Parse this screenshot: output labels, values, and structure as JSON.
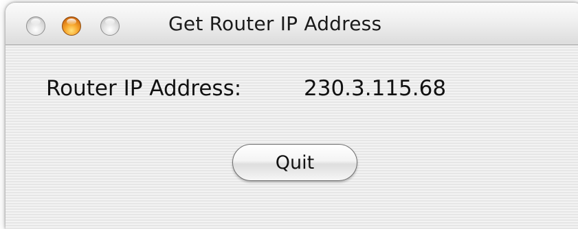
{
  "window": {
    "title": "Get Router IP Address"
  },
  "content": {
    "ip_label": "Router IP Address:",
    "ip_value": "230.3.115.68",
    "quit_label": "Quit"
  },
  "colors": {
    "minimize_button": "#f7a62c",
    "traffic_gray": "#d0d0d0",
    "window_bg": "#ececec"
  }
}
